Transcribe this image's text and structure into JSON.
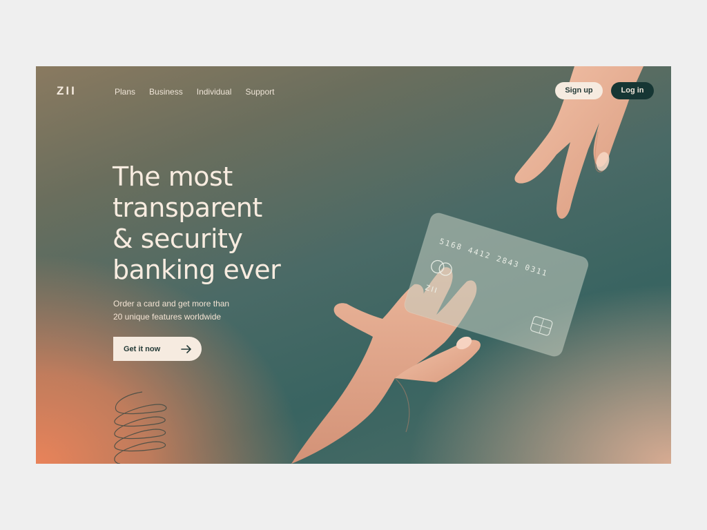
{
  "header": {
    "logo": "ZII",
    "nav": [
      "Plans",
      "Business",
      "Individual",
      "Support"
    ],
    "signup_label": "Sign up",
    "login_label": "Log in"
  },
  "hero": {
    "headline_lines": [
      "The most",
      "transparent",
      "& security",
      "banking ever"
    ],
    "subtitle_lines": [
      "Order a card and get more than",
      "20 unique features worldwide"
    ],
    "cta_label": "Get it now",
    "cta_icon": "arrow-right-icon"
  },
  "card": {
    "number": "5168 4412 2843 0311",
    "brand": "ZII",
    "network_icon": "mastercard-icon",
    "chip_icon": "chip-icon"
  },
  "colors": {
    "cream": "#f6ebe0",
    "dark_teal": "#163634",
    "orange": "#e9835a",
    "teal": "#396461"
  }
}
